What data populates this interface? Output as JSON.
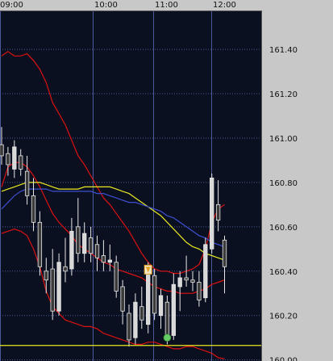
{
  "chart_data": {
    "type": "candlestick",
    "title": "",
    "xlabel": "",
    "ylabel": "",
    "x_ticks": [
      "09:00",
      "10:00",
      "11:00",
      "12:00"
    ],
    "y_ticks": [
      "161.40",
      "161.20",
      "161.00",
      "160.80",
      "160.60",
      "160.40",
      "160.20",
      "160.00"
    ],
    "ylim": [
      159.995,
      161.575
    ],
    "grid": true,
    "colors": {
      "background": "#0b1020",
      "grid": "#4a5a9a",
      "axis_panel": "#c8c8c8",
      "up_candle": "#d8d8d8",
      "down_candle": "#3a3a3a",
      "wick": "#e8e8e8",
      "bollinger": "#dd1111",
      "sma_fast": "#e8e820",
      "sma_slow": "#3d4fd0",
      "horizontal_line": "#e8e820",
      "buy_marker": "#66cc66",
      "sell_marker": "#e0a020"
    },
    "horizontal_line": 160.065,
    "candles": [
      {
        "o": 160.97,
        "h": 161.05,
        "l": 160.88,
        "c": 160.92
      },
      {
        "o": 160.93,
        "h": 160.96,
        "l": 160.83,
        "c": 160.88
      },
      {
        "o": 160.86,
        "h": 160.99,
        "l": 160.82,
        "c": 160.96
      },
      {
        "o": 160.92,
        "h": 160.95,
        "l": 160.83,
        "c": 160.86
      },
      {
        "o": 160.85,
        "h": 160.92,
        "l": 160.7,
        "c": 160.74
      },
      {
        "o": 160.74,
        "h": 160.82,
        "l": 160.58,
        "c": 160.62
      },
      {
        "o": 160.62,
        "h": 160.67,
        "l": 160.38,
        "c": 160.42
      },
      {
        "o": 160.4,
        "h": 160.46,
        "l": 160.3,
        "c": 160.36
      },
      {
        "o": 160.41,
        "h": 160.5,
        "l": 160.18,
        "c": 160.22
      },
      {
        "o": 160.22,
        "h": 160.48,
        "l": 160.2,
        "c": 160.44
      },
      {
        "o": 160.42,
        "h": 160.55,
        "l": 160.35,
        "c": 160.4
      },
      {
        "o": 160.41,
        "h": 160.64,
        "l": 160.38,
        "c": 160.58
      },
      {
        "o": 160.6,
        "h": 160.73,
        "l": 160.44,
        "c": 160.48
      },
      {
        "o": 160.48,
        "h": 160.62,
        "l": 160.44,
        "c": 160.57
      },
      {
        "o": 160.55,
        "h": 160.6,
        "l": 160.44,
        "c": 160.48
      },
      {
        "o": 160.52,
        "h": 160.56,
        "l": 160.4,
        "c": 160.46
      },
      {
        "o": 160.47,
        "h": 160.54,
        "l": 160.4,
        "c": 160.44
      },
      {
        "o": 160.44,
        "h": 160.52,
        "l": 160.4,
        "c": 160.45
      },
      {
        "o": 160.44,
        "h": 160.47,
        "l": 160.28,
        "c": 160.31
      },
      {
        "o": 160.33,
        "h": 160.36,
        "l": 160.16,
        "c": 160.22
      },
      {
        "o": 160.21,
        "h": 160.25,
        "l": 160.06,
        "c": 160.09
      },
      {
        "o": 160.1,
        "h": 160.3,
        "l": 160.07,
        "c": 160.26
      },
      {
        "o": 160.24,
        "h": 160.33,
        "l": 160.14,
        "c": 160.18
      },
      {
        "o": 160.16,
        "h": 160.44,
        "l": 160.12,
        "c": 160.4
      },
      {
        "o": 160.38,
        "h": 160.41,
        "l": 160.18,
        "c": 160.21
      },
      {
        "o": 160.2,
        "h": 160.32,
        "l": 160.14,
        "c": 160.29
      },
      {
        "o": 160.26,
        "h": 160.29,
        "l": 160.07,
        "c": 160.1
      },
      {
        "o": 160.11,
        "h": 160.39,
        "l": 160.09,
        "c": 160.34
      },
      {
        "o": 160.33,
        "h": 160.4,
        "l": 160.22,
        "c": 160.37
      },
      {
        "o": 160.37,
        "h": 160.47,
        "l": 160.33,
        "c": 160.36
      },
      {
        "o": 160.36,
        "h": 160.4,
        "l": 160.31,
        "c": 160.35
      },
      {
        "o": 160.35,
        "h": 160.4,
        "l": 160.24,
        "c": 160.27
      },
      {
        "o": 160.28,
        "h": 160.55,
        "l": 160.26,
        "c": 160.52
      },
      {
        "o": 160.5,
        "h": 160.84,
        "l": 160.48,
        "c": 160.82
      },
      {
        "o": 160.7,
        "h": 160.81,
        "l": 160.58,
        "c": 160.63
      },
      {
        "o": 160.54,
        "h": 160.56,
        "l": 160.3,
        "c": 160.42
      }
    ],
    "series": [
      {
        "style": "bollinger_upper",
        "values": [
          161.37,
          161.39,
          161.37,
          161.37,
          161.38,
          161.35,
          161.31,
          161.25,
          161.16,
          161.11,
          161.06,
          160.99,
          160.92,
          160.88,
          160.83,
          160.78,
          160.73,
          160.7,
          160.66,
          160.62,
          160.58,
          160.53,
          160.48,
          160.44,
          160.41,
          160.4,
          160.4,
          160.39,
          160.39,
          160.4,
          160.41,
          160.43,
          160.5,
          160.62,
          160.68,
          160.7
        ]
      },
      {
        "style": "bollinger_middle",
        "values": [
          160.78,
          160.87,
          160.89,
          160.89,
          160.87,
          160.83,
          160.78,
          160.72,
          160.66,
          160.62,
          160.59,
          160.56,
          160.52,
          160.5,
          160.48,
          160.46,
          160.44,
          160.43,
          160.41,
          160.4,
          160.39,
          160.38,
          160.37,
          160.35,
          160.33,
          160.32,
          160.31,
          160.31,
          160.3,
          160.3,
          160.3,
          160.31,
          160.32,
          160.34,
          160.35,
          160.36
        ]
      },
      {
        "style": "bollinger_lower",
        "values": [
          160.57,
          160.58,
          160.59,
          160.58,
          160.56,
          160.5,
          160.42,
          160.31,
          160.24,
          160.21,
          160.18,
          160.17,
          160.16,
          160.15,
          160.15,
          160.14,
          160.12,
          160.11,
          160.1,
          160.09,
          160.08,
          160.07,
          160.07,
          160.08,
          160.08,
          160.07,
          160.06,
          160.05,
          160.05,
          160.06,
          160.06,
          160.05,
          160.04,
          160.03,
          160.01,
          160.005
        ]
      },
      {
        "style": "sma_fast",
        "values": [
          160.76,
          160.77,
          160.78,
          160.79,
          160.8,
          160.8,
          160.8,
          160.79,
          160.78,
          160.77,
          160.77,
          160.77,
          160.77,
          160.78,
          160.78,
          160.78,
          160.78,
          160.78,
          160.77,
          160.76,
          160.75,
          160.73,
          160.71,
          160.69,
          160.67,
          160.65,
          160.62,
          160.59,
          160.56,
          160.53,
          160.51,
          160.5,
          160.48,
          160.47,
          160.46,
          160.45
        ]
      },
      {
        "style": "sma_slow",
        "values": [
          160.68,
          160.71,
          160.74,
          160.76,
          160.77,
          160.77,
          160.77,
          160.77,
          160.76,
          160.76,
          160.76,
          160.76,
          160.76,
          160.76,
          160.76,
          160.75,
          160.75,
          160.74,
          160.73,
          160.72,
          160.71,
          160.71,
          160.7,
          160.69,
          160.68,
          160.67,
          160.65,
          160.64,
          160.62,
          160.6,
          160.58,
          160.56,
          160.55,
          160.53,
          160.52,
          160.51
        ]
      }
    ],
    "markers": [
      {
        "type": "sell",
        "candle": 23,
        "y": 160.405
      },
      {
        "type": "buy",
        "candle": 26,
        "y": 160.1
      }
    ]
  }
}
